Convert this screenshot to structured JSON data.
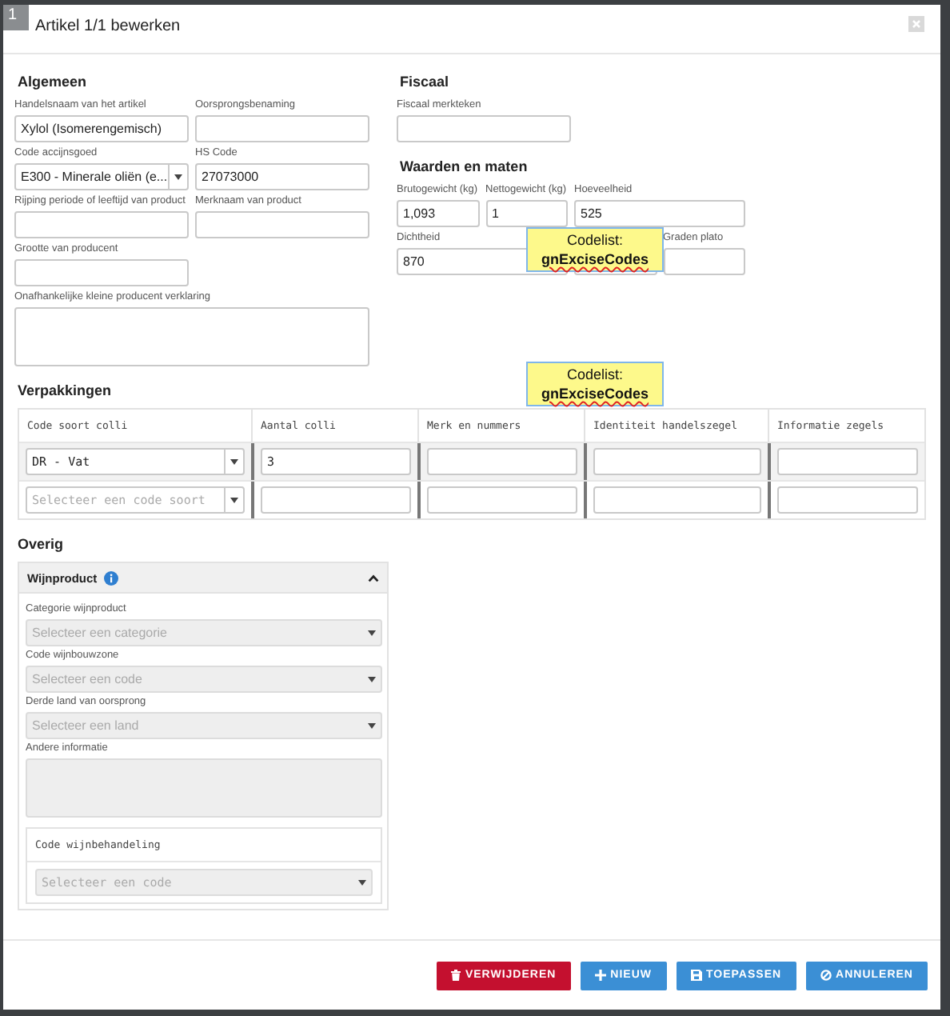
{
  "dialog": {
    "badge": "1",
    "title": "Artikel 1/1 bewerken"
  },
  "algemeen": {
    "heading": "Algemeen",
    "fields": [
      {
        "label": "Handelsnaam van het artikel",
        "value": "Xylol (Isomerengemisch)",
        "kind": "text"
      },
      {
        "label": "Oorsprongsbenaming",
        "kind": "text"
      },
      {
        "label": "Code accijnsgoed",
        "value": "E300 - Minerale oliën (e...",
        "kind": "select"
      },
      {
        "label": "HS Code",
        "value": "27073000",
        "kind": "text"
      },
      {
        "label": "Rijping periode of leeftijd van product",
        "kind": "text"
      },
      {
        "label": "Merknaam van product",
        "kind": "text"
      },
      {
        "label": "Grootte van producent",
        "kind": "text"
      },
      {
        "label": "Onafhankelijke kleine producent verklaring",
        "kind": "textarea"
      }
    ]
  },
  "fiscaal": {
    "heading": "Fiscaal",
    "fields": [
      {
        "label": "Fiscaal merkteken",
        "kind": "text"
      }
    ]
  },
  "waarden": {
    "heading": "Waarden en maten",
    "fields": [
      {
        "label": "Brutogewicht (kg)",
        "value": "1,093",
        "kind": "text"
      },
      {
        "label": "Nettogewicht (kg)",
        "value": "1",
        "kind": "text"
      },
      {
        "label": "Hoeveelheid",
        "value": "525",
        "kind": "text"
      },
      {
        "label": "Dichtheid",
        "value": "870",
        "kind": "text"
      },
      {
        "kind": "text"
      },
      {
        "label": "Graden plato",
        "kind": "text"
      }
    ]
  },
  "overlays": [
    {
      "lines": [
        "Codelist:",
        "gnExciseCodes"
      ]
    },
    {
      "lines": [
        "Codelist:",
        "gnExciseCodes"
      ]
    }
  ],
  "packaging": {
    "heading": "Verpakkingen",
    "columns": [
      "Code soort colli",
      "Aantal colli",
      "Merk en nummers",
      "Identiteit handelszegel",
      "Informatie zegels"
    ],
    "rows": [
      [
        {
          "kind": "select",
          "value": "DR - Vat"
        },
        {
          "kind": "text",
          "value": "3"
        },
        {
          "kind": "text"
        },
        {
          "kind": "text"
        },
        {
          "kind": "text"
        }
      ],
      [
        {
          "kind": "select",
          "placeholder": "Selecteer een code soort"
        },
        {
          "kind": "text"
        },
        {
          "kind": "text"
        },
        {
          "kind": "text"
        },
        {
          "kind": "text"
        }
      ]
    ]
  },
  "overig": {
    "heading": "Overig",
    "panel": {
      "title": "Wijnproduct",
      "expanded": true,
      "fields": [
        {
          "label": "Categorie wijnproduct",
          "placeholder": "Selecteer een categorie",
          "kind": "select",
          "disabled": true
        },
        {
          "label": "Code wijnbouwzone",
          "placeholder": "Selecteer een code",
          "kind": "select",
          "disabled": true
        },
        {
          "label": "Derde land van oorsprong",
          "placeholder": "Selecteer een land",
          "kind": "select",
          "disabled": true
        },
        {
          "label": "Andere informatie",
          "kind": "textarea",
          "disabled": true
        }
      ],
      "subpanel": {
        "title": "Code wijnbehandeling",
        "placeholder": "Selecteer een code",
        "disabled": true
      }
    }
  },
  "buttons": [
    {
      "label": "VERWIJDEREN",
      "kind": "danger"
    },
    {
      "label": "NIEUW",
      "kind": "primary"
    },
    {
      "label": "TOEPASSEN",
      "kind": "primary"
    },
    {
      "label": "ANNULEREN",
      "kind": "primary"
    }
  ]
}
